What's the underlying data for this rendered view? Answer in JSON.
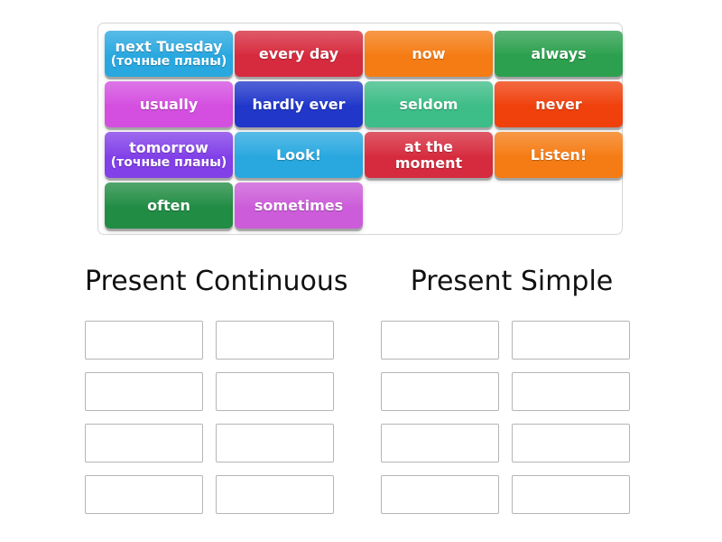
{
  "activity": {
    "type": "group-sort",
    "word_bank": {
      "tiles": [
        {
          "label": "next Tuesday",
          "sub": "(точные планы)",
          "color": "#29a8e0"
        },
        {
          "label": "every day",
          "sub": "",
          "color": "#d62b3e"
        },
        {
          "label": "now",
          "sub": "",
          "color": "#f57c14"
        },
        {
          "label": "always",
          "sub": "",
          "color": "#2ca04e"
        },
        {
          "label": "usually",
          "sub": "",
          "color": "#d44fe0"
        },
        {
          "label": "hardly ever",
          "sub": "",
          "color": "#2137ca"
        },
        {
          "label": "seldom",
          "sub": "",
          "color": "#3dbd87"
        },
        {
          "label": "never",
          "sub": "",
          "color": "#f0400c"
        },
        {
          "label": "tomorrow",
          "sub": "(точные планы)",
          "color": "#8240e8"
        },
        {
          "label": "Look!",
          "sub": "",
          "color": "#29a8e0"
        },
        {
          "label": "at the moment",
          "sub": "",
          "color": "#d62b3e"
        },
        {
          "label": "Listen!",
          "sub": "",
          "color": "#f57c14"
        },
        {
          "label": "often",
          "sub": "",
          "color": "#218c43"
        },
        {
          "label": "sometimes",
          "sub": "",
          "color": "#cc5cd9"
        }
      ]
    },
    "columns": [
      {
        "title": "Present Continuous",
        "slots": [
          "",
          "",
          "",
          "",
          "",
          "",
          "",
          ""
        ]
      },
      {
        "title": "Present Simple",
        "slots": [
          "",
          "",
          "",
          "",
          "",
          "",
          "",
          ""
        ]
      }
    ]
  }
}
